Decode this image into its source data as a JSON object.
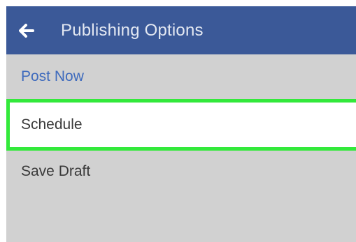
{
  "appbar": {
    "back_icon": "arrow-left-icon",
    "title": "Publishing Options",
    "background": "#3b5998"
  },
  "options": [
    {
      "label": "Post Now",
      "color": "#3f6bbd"
    },
    {
      "label": "Schedule",
      "highlighted": true,
      "highlight_color": "#33e93b"
    },
    {
      "label": "Save Draft"
    }
  ]
}
